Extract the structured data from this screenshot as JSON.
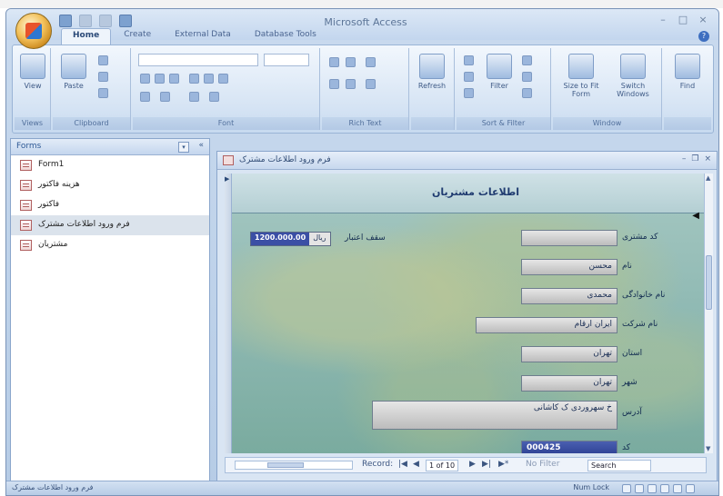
{
  "app": {
    "title": "Microsoft Access"
  },
  "ribbon": {
    "tabs": [
      "Home",
      "Create",
      "External Data",
      "Database Tools"
    ],
    "groups": {
      "views": {
        "label": "Views",
        "view_btn": "View"
      },
      "clipboard": {
        "label": "Clipboard",
        "paste_btn": "Paste"
      },
      "font": {
        "label": "Font"
      },
      "rich_text": {
        "label": "Rich Text"
      },
      "records": {
        "refresh_btn": "Refresh"
      },
      "sort_filter": {
        "label": "Sort & Filter",
        "filter_btn": "Filter"
      },
      "window": {
        "label": "Window",
        "size_btn": "Size to Fit Form",
        "switch_btn": "Switch Windows"
      },
      "find": {
        "find_btn": "Find"
      }
    }
  },
  "nav_pane": {
    "header": "Forms",
    "items": [
      {
        "label": "Form1"
      },
      {
        "label": "هزینه فاکتور"
      },
      {
        "label": "فاکتور"
      },
      {
        "label": "فرم ورود اطلاعات مشترک",
        "selected": true
      },
      {
        "label": "مشتریان"
      }
    ]
  },
  "form": {
    "window_title": "فرم ورود اطلاعات مشترک",
    "header_title": "اطلاعات مشتریان",
    "fields": [
      {
        "label": "کد مشتری",
        "value": ""
      },
      {
        "label": "نام",
        "value": "محسن"
      },
      {
        "label": "نام خانوادگی",
        "value": "محمدی"
      },
      {
        "label": "نام شرکت",
        "value": "ایران ارقام"
      },
      {
        "label": "استان",
        "value": "تهران"
      },
      {
        "label": "شهر",
        "value": "تهران"
      },
      {
        "label": "آدرس",
        "value": "خ سهروردی ک کاشانی"
      },
      {
        "label": "کد",
        "value": "000425"
      }
    ],
    "credit": {
      "label": "سقف اعتبار",
      "amount": "1200.000.00",
      "currency": "ریال"
    }
  },
  "record_nav": {
    "label": "Record:",
    "position": "1 of 10",
    "filter": "No Filter",
    "search": "Search"
  },
  "status": {
    "left": "فرم ورود اطلاعات مشترک",
    "right": "Num Lock"
  }
}
